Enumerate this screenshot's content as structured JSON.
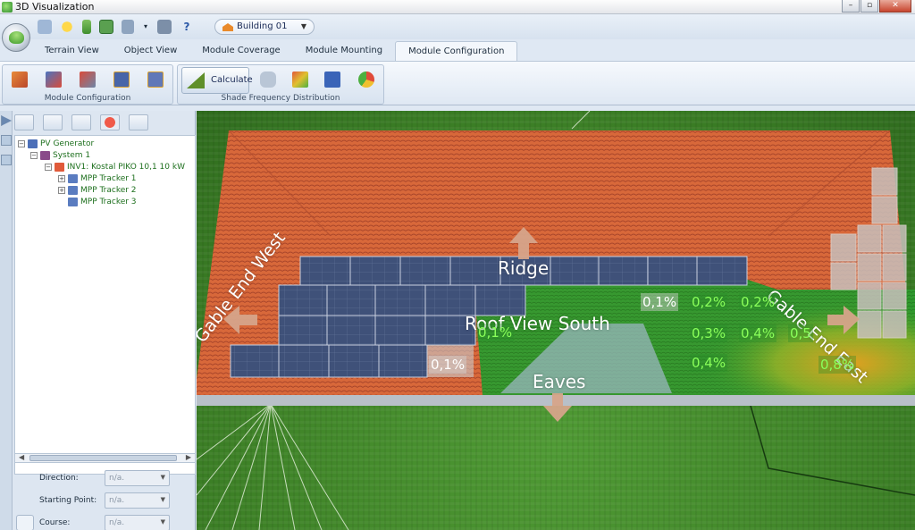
{
  "window": {
    "title": "3D Visualization",
    "controls": [
      "–",
      "▫",
      "✕"
    ]
  },
  "quick_access": {
    "building_selector": "Building 01",
    "help": "?"
  },
  "tabs": [
    {
      "label": "Terrain View"
    },
    {
      "label": "Object View"
    },
    {
      "label": "Module Coverage"
    },
    {
      "label": "Module Mounting"
    },
    {
      "label": "Module Configuration"
    }
  ],
  "ribbon": {
    "group_module_configuration": "Module Configuration",
    "group_shade_frequency": "Shade Frequency Distribution",
    "calculate": "Calculate"
  },
  "tree": {
    "pv_generator": "PV Generator",
    "system": "System 1",
    "inverter": "INV1: Kostal PIKO 10,1 10 kW",
    "trackers": [
      "MPP Tracker 1",
      "MPP Tracker 2",
      "MPP Tracker 3"
    ]
  },
  "properties": {
    "direction_label": "Direction:",
    "direction_value": "n/a.",
    "starting_point_label": "Starting Point:",
    "starting_point_value": "n/a.",
    "course_label": "Course:",
    "course_value": "n/a."
  },
  "viewport": {
    "ridge": "Ridge",
    "roof_view": "Roof View South",
    "eaves": "Eaves",
    "gable_west": "Gable End West",
    "gable_east": "Gable End East",
    "shade_values": [
      "0,1%",
      "0,2%",
      "0,2%",
      "0,1%",
      "0,3%",
      "0,4%",
      "0,5",
      "0,4%",
      "0,1%",
      "0,8%"
    ]
  },
  "colors": {
    "roof": "#d9693a",
    "grass": "#3f8a2a",
    "panel": "#3d4f78",
    "accent": "#1d6f1d"
  }
}
